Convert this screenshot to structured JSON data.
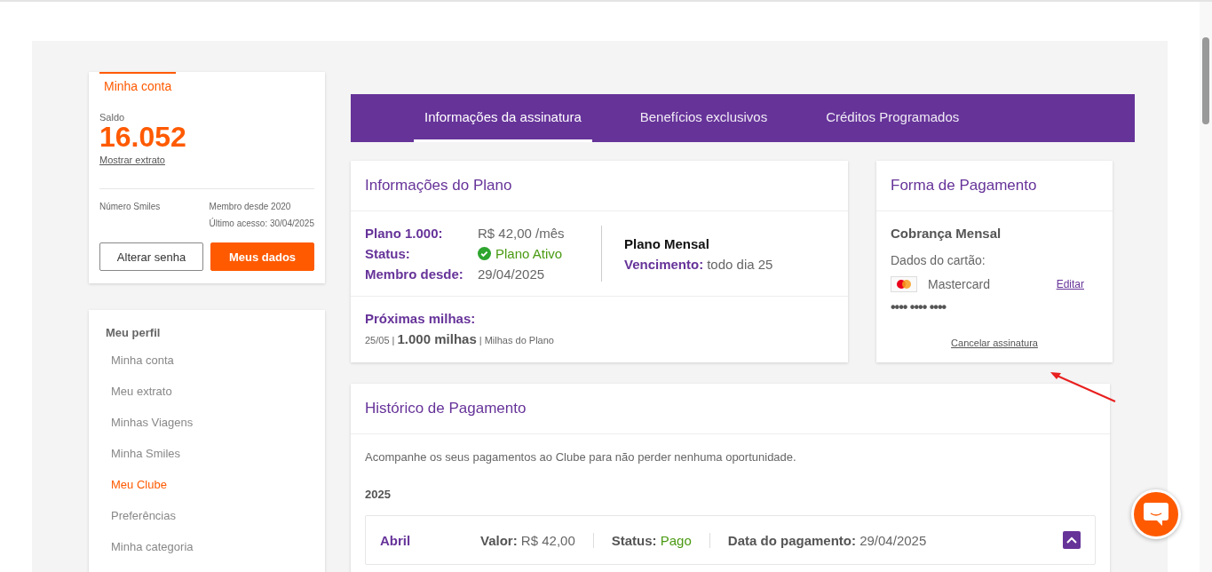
{
  "account": {
    "tab": "Minha conta",
    "balance_label": "Saldo",
    "balance": "16.052",
    "statement_link": "Mostrar extrato",
    "number_label": "Número Smiles",
    "member_since": "Membro desde 2020",
    "last_access": "Último acesso: 30/04/2025",
    "buttons": [
      {
        "label": "Alterar senha",
        "kind": "outline"
      },
      {
        "label": "Meus dados",
        "kind": "primary"
      }
    ]
  },
  "sidebar": {
    "title": "Meu perfil",
    "items": [
      {
        "label": "Minha conta",
        "selected": false
      },
      {
        "label": "Meu extrato",
        "selected": false
      },
      {
        "label": "Minhas Viagens",
        "selected": false
      },
      {
        "label": "Minha Smiles",
        "selected": false
      },
      {
        "label": "Meu Clube",
        "selected": true
      },
      {
        "label": "Preferências",
        "selected": false
      },
      {
        "label": "Minha categoria",
        "selected": false
      }
    ]
  },
  "tabs": [
    {
      "label": "Informações da assinatura",
      "selected": true
    },
    {
      "label": "Benefícios exclusivos",
      "selected": false
    },
    {
      "label": "Créditos Programados",
      "selected": false
    }
  ],
  "plan": {
    "title": "Informações do Plano",
    "rows": [
      {
        "label": "Plano 1.000:",
        "value": "R$ 42,00 /mês",
        "kind": "text"
      },
      {
        "label": "Status:",
        "value": "Plano Ativo",
        "kind": "status"
      },
      {
        "label": "Membro desde:",
        "value": "29/04/2025",
        "kind": "text"
      }
    ],
    "cycle": "Plano Mensal",
    "due_label": "Vencimento:",
    "due_value": "todo dia 25",
    "next_title": "Próximas milhas:",
    "next_line": "25/05 | **1.000 milhas** | Milhas do Plano"
  },
  "payment": {
    "title": "Forma de Pagamento",
    "billing": "Cobrança Mensal",
    "card_label": "Dados do cartão:",
    "card_brand": "Mastercard",
    "edit_link": "Editar",
    "card_number": "•••• •••• ••••",
    "cancel_link": "Cancelar assinatura"
  },
  "history": {
    "title": "Histórico de Pagamento",
    "intro": "Acompanhe os seus pagamentos ao Clube para não perder nenhuma oportunidade.",
    "year": "2025",
    "entries": [
      {
        "month": "Abril",
        "amount_label": "Valor:",
        "amount": "R$ 42,00",
        "status_label": "Status:",
        "status": "Pago",
        "date_label": "Data do pagamento:",
        "date": "29/04/2025",
        "expanded": true
      }
    ]
  }
}
